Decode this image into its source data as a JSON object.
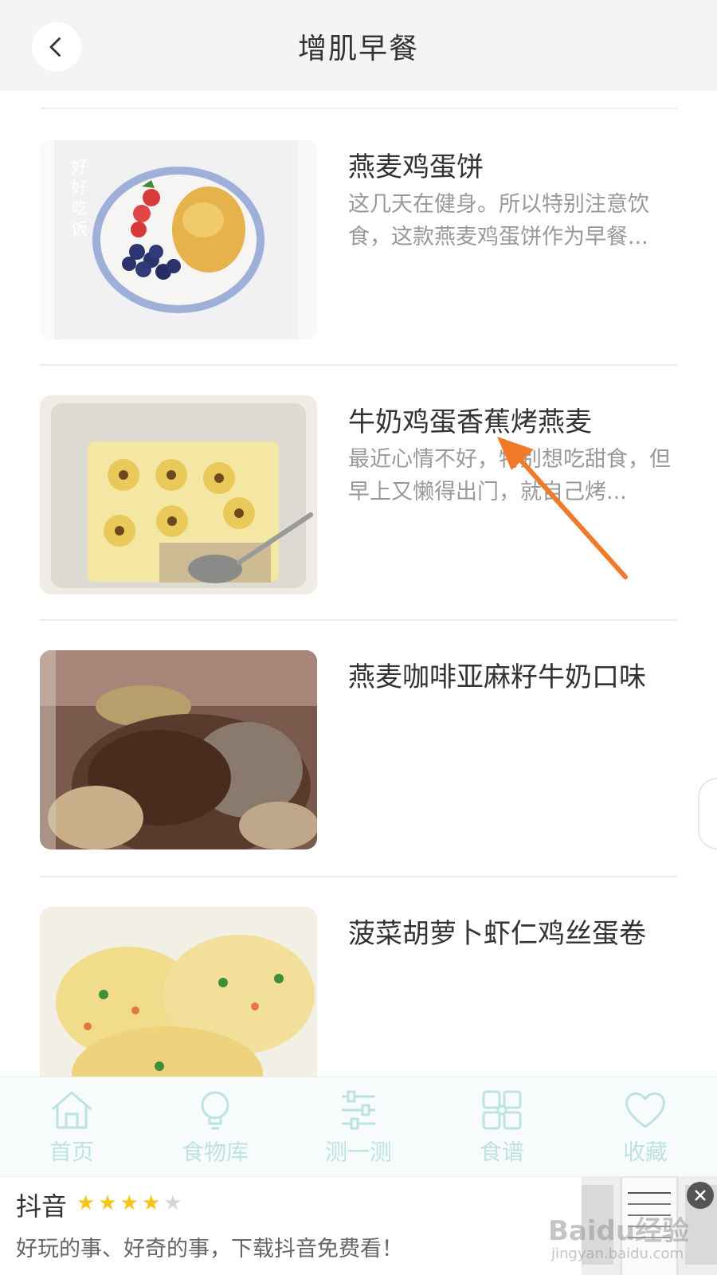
{
  "header": {
    "title": "增肌早餐",
    "back_icon": "back-arrow-icon"
  },
  "recipes": [
    {
      "title": "燕麦鸡蛋饼",
      "desc": "这几天在健身。所以特别注意饮食，这款燕麦鸡蛋饼作为早餐...",
      "image": "oat-egg-pancake-photo",
      "image_text": "好好吃饭"
    },
    {
      "title": "牛奶鸡蛋香蕉烤燕麦",
      "desc": "最近心情不好，特别想吃甜食，但早上又懒得出门，就自己烤...",
      "image": "banana-baked-oats-photo"
    },
    {
      "title": "燕麦咖啡亚麻籽牛奶口味",
      "desc": "",
      "image": "oat-coffee-flaxseed-photo"
    },
    {
      "title": "菠菜胡萝卜虾仁鸡丝蛋卷",
      "desc": "",
      "image": "spinach-egg-roll-photo"
    }
  ],
  "bottom_nav": [
    {
      "label": "首页",
      "icon": "home-icon"
    },
    {
      "label": "食物库",
      "icon": "lightbulb-icon"
    },
    {
      "label": "测一测",
      "icon": "sliders-icon"
    },
    {
      "label": "食谱",
      "icon": "grid-icon"
    },
    {
      "label": "收藏",
      "icon": "heart-icon"
    }
  ],
  "ad": {
    "app_name": "抖音",
    "rating": 4,
    "rating_max": 5,
    "text": "好玩的事、好奇的事，下载抖音免费看！",
    "watermark": "Baidu经验",
    "watermark_sub": "jingyan.baidu.com"
  },
  "colors": {
    "nav_tint": "#bde3e1",
    "arrow": "#f07a2a",
    "star_on": "#f5c518",
    "star_off": "#d6d6d6"
  }
}
